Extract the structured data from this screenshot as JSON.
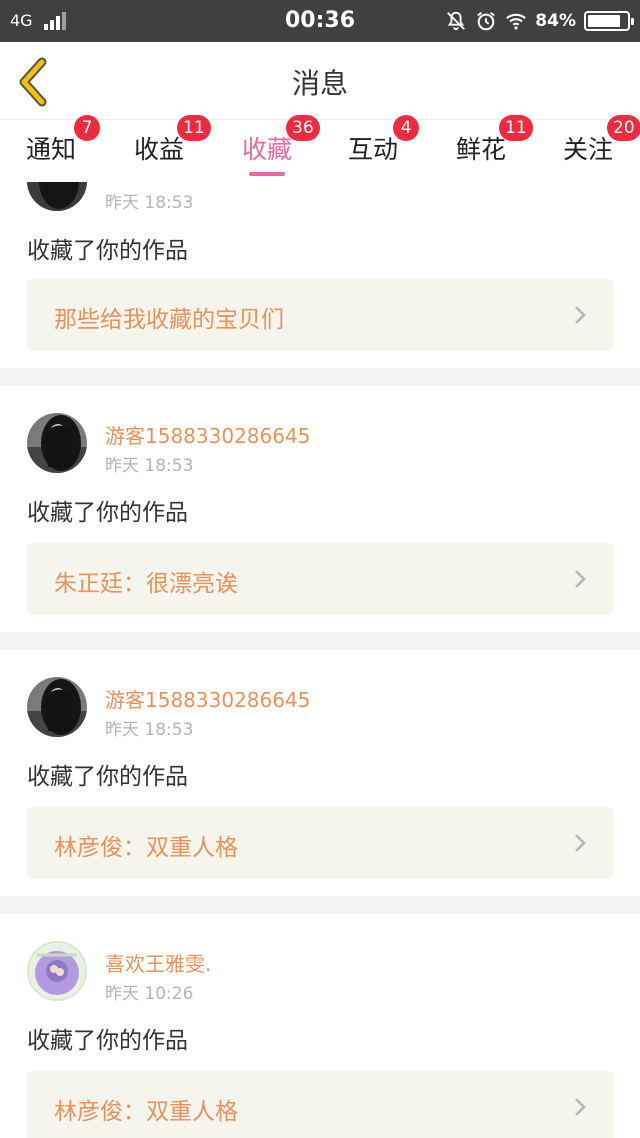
{
  "status_bar": {
    "network": "4G",
    "time": "00:36",
    "battery": "84%",
    "battery_level": 0.84
  },
  "header": {
    "title": "消息"
  },
  "tabs": [
    {
      "label": "通知",
      "badge": "7"
    },
    {
      "label": "收益",
      "badge": "11"
    },
    {
      "label": "收藏",
      "badge": "36"
    },
    {
      "label": "互动",
      "badge": "4"
    },
    {
      "label": "鲜花",
      "badge": "11"
    },
    {
      "label": "关注",
      "badge": "20"
    }
  ],
  "active_tab": "收藏",
  "feed": [
    {
      "time": "昨天 18:53",
      "action": "收藏了你的作品",
      "ref": "那些给我收藏的宝贝们"
    },
    {
      "user": "游客1588330286645",
      "time": "昨天 18:53",
      "action": "收藏了你的作品",
      "ref": "朱正廷：很漂亮诶"
    },
    {
      "user": "游客1588330286645",
      "time": "昨天 18:53",
      "action": "收藏了你的作品",
      "ref": "林彦俊：双重人格"
    },
    {
      "user": "喜欢王雅雯.",
      "time": "昨天 10:26",
      "action": "收藏了你的作品",
      "ref": "林彦俊：双重人格"
    }
  ],
  "colors": {
    "accent": "#e86aa1",
    "badge": "#ee2a3f",
    "username": "#e9925a",
    "back_arrow": "#f2c200",
    "statusbar": "#404040"
  },
  "icons": [
    "back-icon",
    "mute-icon",
    "alarm-icon",
    "wifi-icon",
    "battery-icon",
    "chevron-right-icon"
  ]
}
